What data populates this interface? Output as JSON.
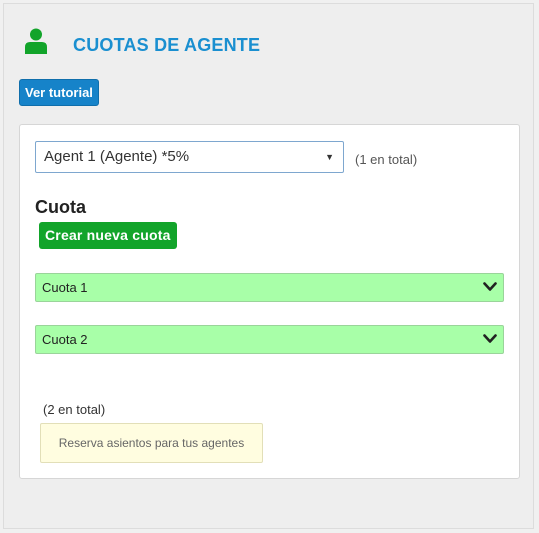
{
  "header": {
    "title": "CUOTAS DE AGENTE",
    "icon": "user-icon",
    "icon_color": "#12a42a"
  },
  "tutorial": {
    "label": "Ver tutorial"
  },
  "agent_select": {
    "selected": "Agent 1 (Agente) *5%",
    "total": "(1 en total)"
  },
  "quotas": {
    "title": "Cuota",
    "new_label": "Crear nueva cuota",
    "items": [
      {
        "label": "Cuota 1"
      },
      {
        "label": "Cuota 2"
      }
    ],
    "total": "(2 en total)",
    "note": "Reserva asientos para tus agentes"
  }
}
